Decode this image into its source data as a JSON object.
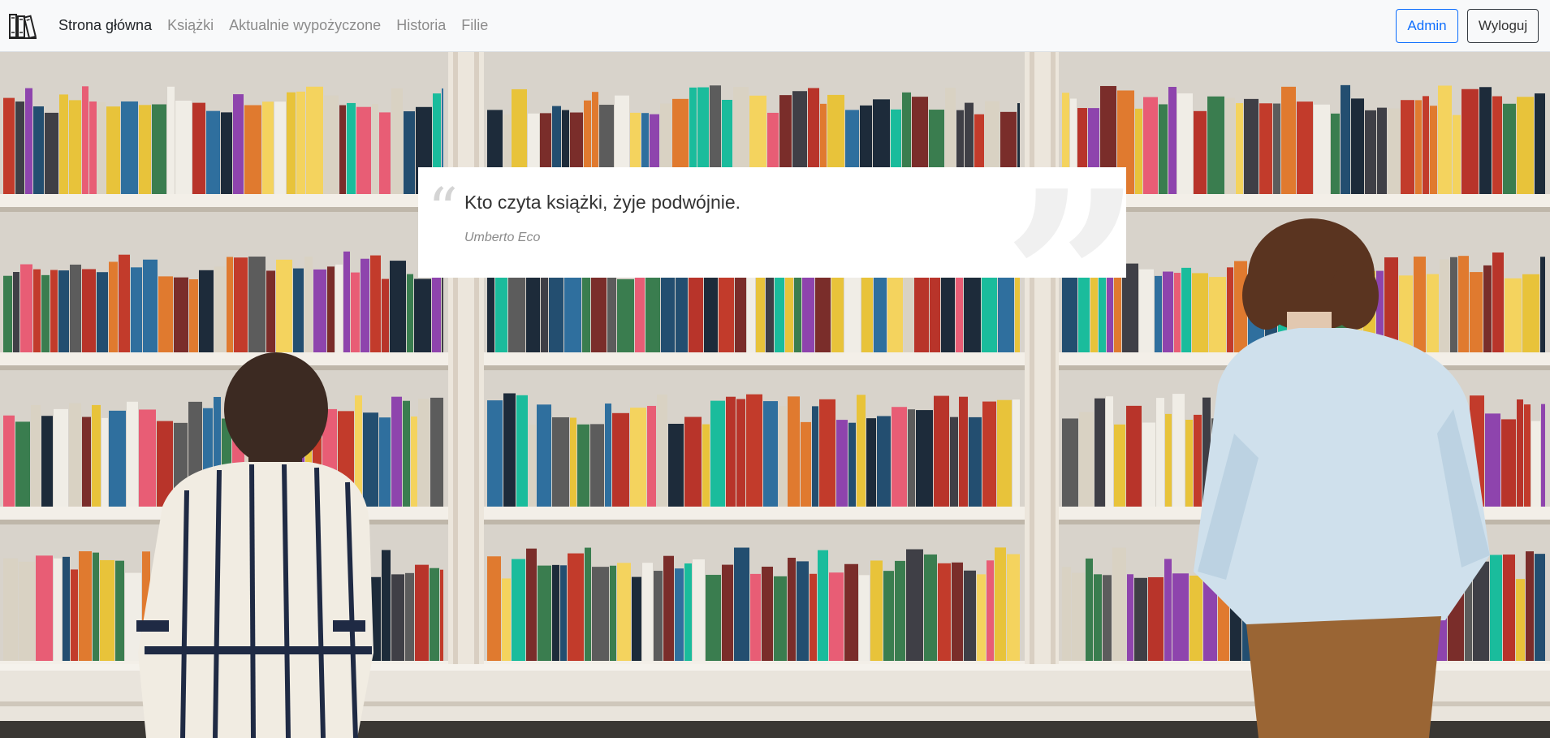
{
  "nav": {
    "brand_icon": "books-icon",
    "links": [
      {
        "label": "Strona główna",
        "active": true
      },
      {
        "label": "Książki",
        "active": false
      },
      {
        "label": "Aktualnie wypożyczone",
        "active": false
      },
      {
        "label": "Historia",
        "active": false
      },
      {
        "label": "Filie",
        "active": false
      }
    ],
    "admin_label": "Admin",
    "logout_label": "Wyloguj"
  },
  "quote": {
    "text": "Kto czyta książki, żyje podwójnie.",
    "author": "Umberto Eco"
  },
  "colors": {
    "accent": "#0d6efd",
    "navbar_bg": "#f8f9fa"
  }
}
